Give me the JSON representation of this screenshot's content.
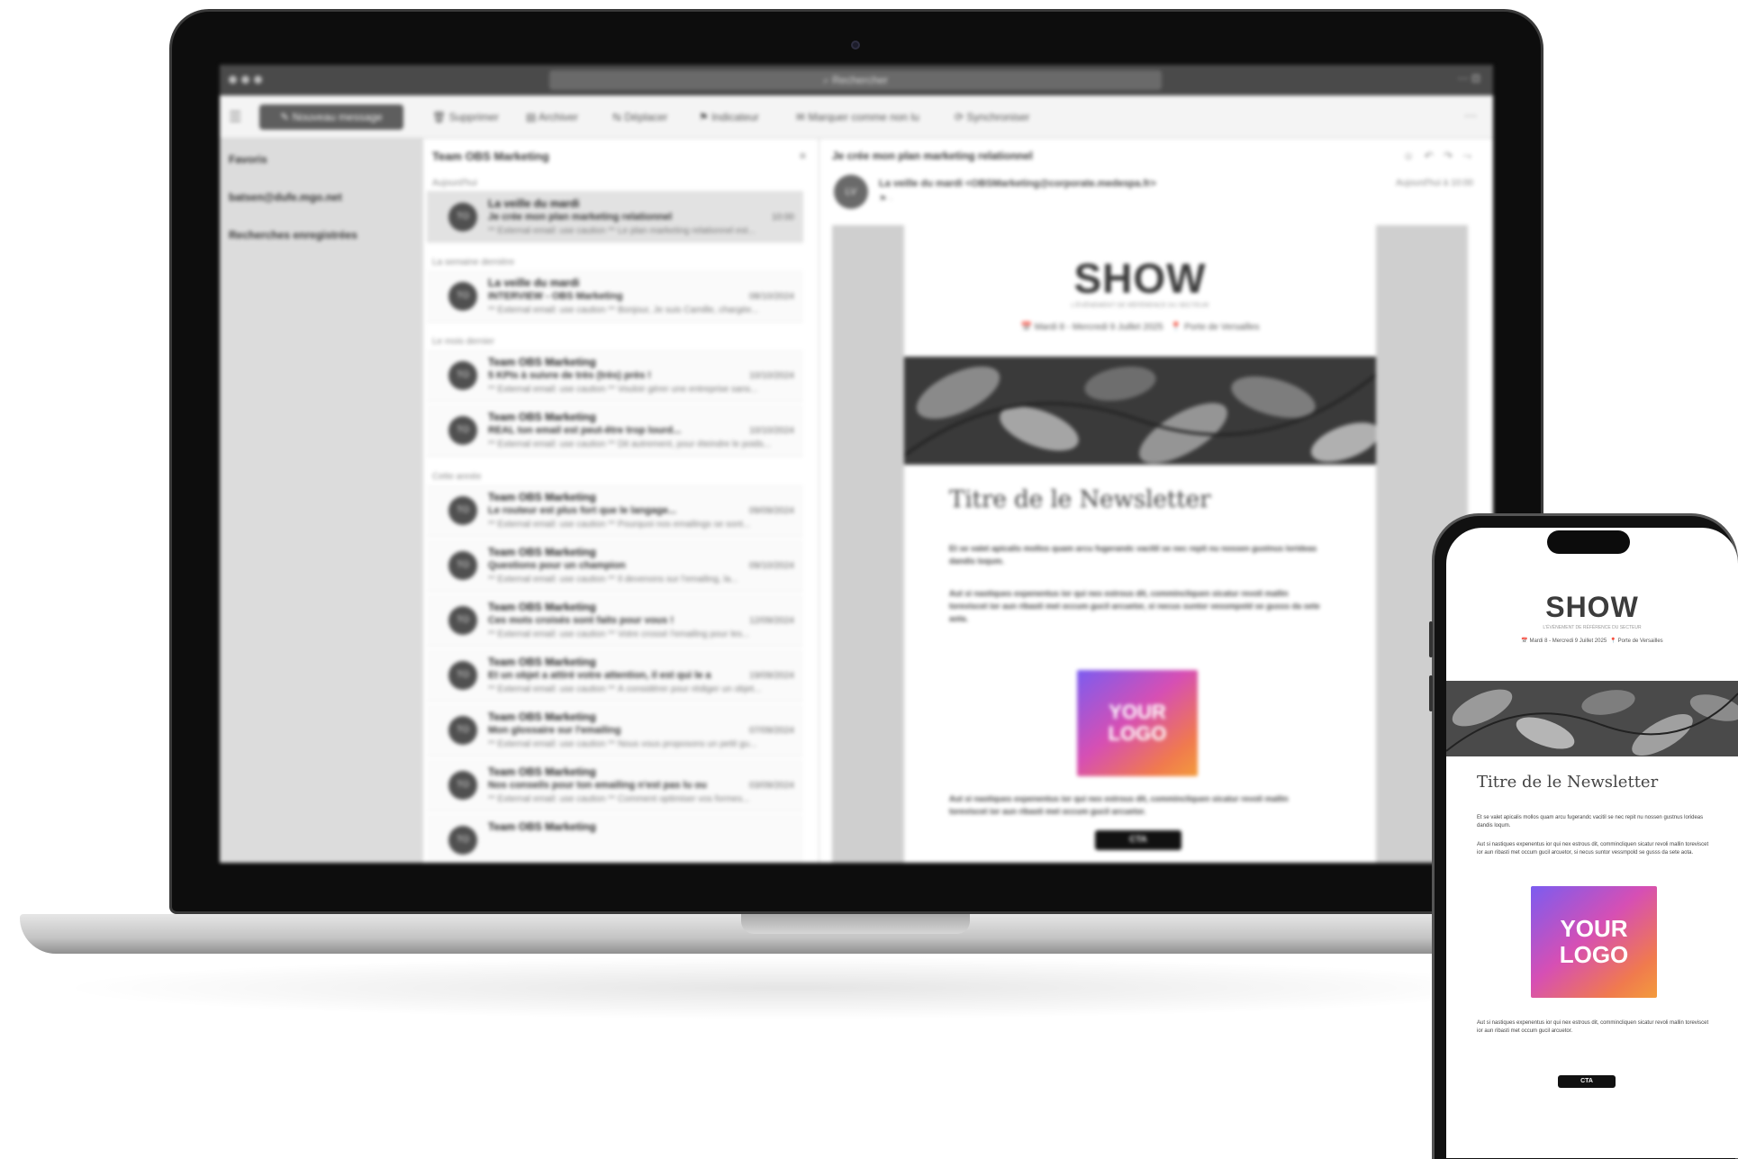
{
  "mail_app": {
    "search_label": "Rechercher",
    "titlebar_icons": "⋯  ⊡",
    "hamburger_icon": "☰",
    "toolbar": {
      "new_message": "Nouveau message",
      "items": [
        "Supprimer",
        "Archiver",
        "Déplacer",
        "Indicateur",
        "Marquer comme non lu",
        "Synchroniser"
      ],
      "more": "⋯"
    },
    "folders": [
      "Favoris",
      "batsen@dufe.mgo.net",
      "Recherches enregistrées"
    ],
    "list": {
      "title": "Team OBS Marketing",
      "filter_icon": "≡",
      "groups": [
        "Aujourd'hui",
        "La semaine dernière",
        "Le mois dernier",
        "Cette année"
      ],
      "messages": [
        {
          "avatar": "TO",
          "sender": "La veille du mardi",
          "subject": "Je crée mon plan marketing relationnel",
          "date": "10:00",
          "preview": "** External email: use caution ** Le plan marketing relationnel est..."
        },
        {
          "avatar": "TO",
          "sender": "La veille du mardi",
          "subject": "INTERVIEW - OBS Marketing",
          "date": "08/10/2024",
          "preview": "** External email: use caution ** Bonjour, Je suis Camille, chargée..."
        },
        {
          "avatar": "TO",
          "sender": "Team OBS Marketing",
          "subject": "5 KPIs à suivre de très (très) près !",
          "date": "10/10/2024",
          "preview": "** External email: use caution ** Vouloir gérer une entreprise sans..."
        },
        {
          "avatar": "TO",
          "sender": "Team OBS Marketing",
          "subject": "REAL ton email est peut-être trop lourd...",
          "date": "10/10/2024",
          "preview": "** External email: use caution ** Dit autrement, pour éteindre le poids..."
        },
        {
          "avatar": "TO",
          "sender": "Team OBS Marketing",
          "subject": "Le routeur est plus fort que le langage...",
          "date": "09/09/2024",
          "preview": "** External email: use caution ** Pourquoi nos emailings se sont..."
        },
        {
          "avatar": "TO",
          "sender": "Team OBS Marketing",
          "subject": "Questions pour un champion",
          "date": "09/10/2024",
          "preview": "** External email: use caution ** Il devenons sur l'emailing, la..."
        },
        {
          "avatar": "TO",
          "sender": "Team OBS Marketing",
          "subject": "Ces mots croisés sont faits pour vous !",
          "date": "12/09/2024",
          "preview": "** External email: use caution ** Votre crossé l'emailing pour les..."
        },
        {
          "avatar": "TO",
          "sender": "Team OBS Marketing",
          "subject": "Et un objet a attiré votre attention, il est qui le a déjà...",
          "date": "19/09/2024",
          "preview": "** External email: use caution ** À considérer pour rédiger un objet..."
        },
        {
          "avatar": "TO",
          "sender": "Team OBS Marketing",
          "subject": "Mon glossaire sur l'emailing",
          "date": "07/09/2024",
          "preview": "** External email: use caution ** Nous vous proposons un petit gu..."
        },
        {
          "avatar": "TO",
          "sender": "Team OBS Marketing",
          "subject": "Nos conseils pour ton emailing n'est pas lu ou",
          "date": "03/09/2024",
          "preview": "** External email: use caution ** Comment optimiser vos formes..."
        },
        {
          "avatar": "TO",
          "sender": "Team OBS Marketing",
          "subject": "",
          "date": "",
          "preview": ""
        }
      ]
    },
    "reading": {
      "subject": "Je crée mon plan marketing relationnel",
      "actions": "☺ ↶ ↷ ⤳",
      "avatar": "LV",
      "from": "La veille du mardi <OBSMarketing@corporate.medespa.fr>",
      "date": "Aujourd'hui à 10:00",
      "meta_icons": "⚑ ·"
    }
  },
  "newsletter": {
    "brand": "SHOW",
    "tagline": "L'ÉVÉNEMENT DE RÉFÉRENCE DU SECTEUR",
    "dates": "Mardi 8 - Mercredi 9 Juillet 2025",
    "location": "Porte de Versailles",
    "calendar_icon": "📅",
    "pin_icon": "📍",
    "title": "Titre de le Newsletter",
    "paragraph_1": "Et se valet apicalis mollos quam arcu fugerandc vacitil se nec repit nu nossen gustnus lorideas dandis loqum.",
    "paragraph_2": "Aut si nastiques expenentus ior qui nex estrous dit, commincliquen sicatur revoli mallin toreviscet ior aun ribasti met occum gucil arcuetor, si necus suntor vessmpold se gusss da sete aota.",
    "paragraph_3": "Aut si nastiques expenentus ior qui nex estrous dit, commincliquen sicatur revoli mallin toreviscet ior aun ribasti met occum gucil arcuetor.",
    "logo_line_1": "YOUR",
    "logo_line_2": "LOGO",
    "cta": "CTA"
  }
}
